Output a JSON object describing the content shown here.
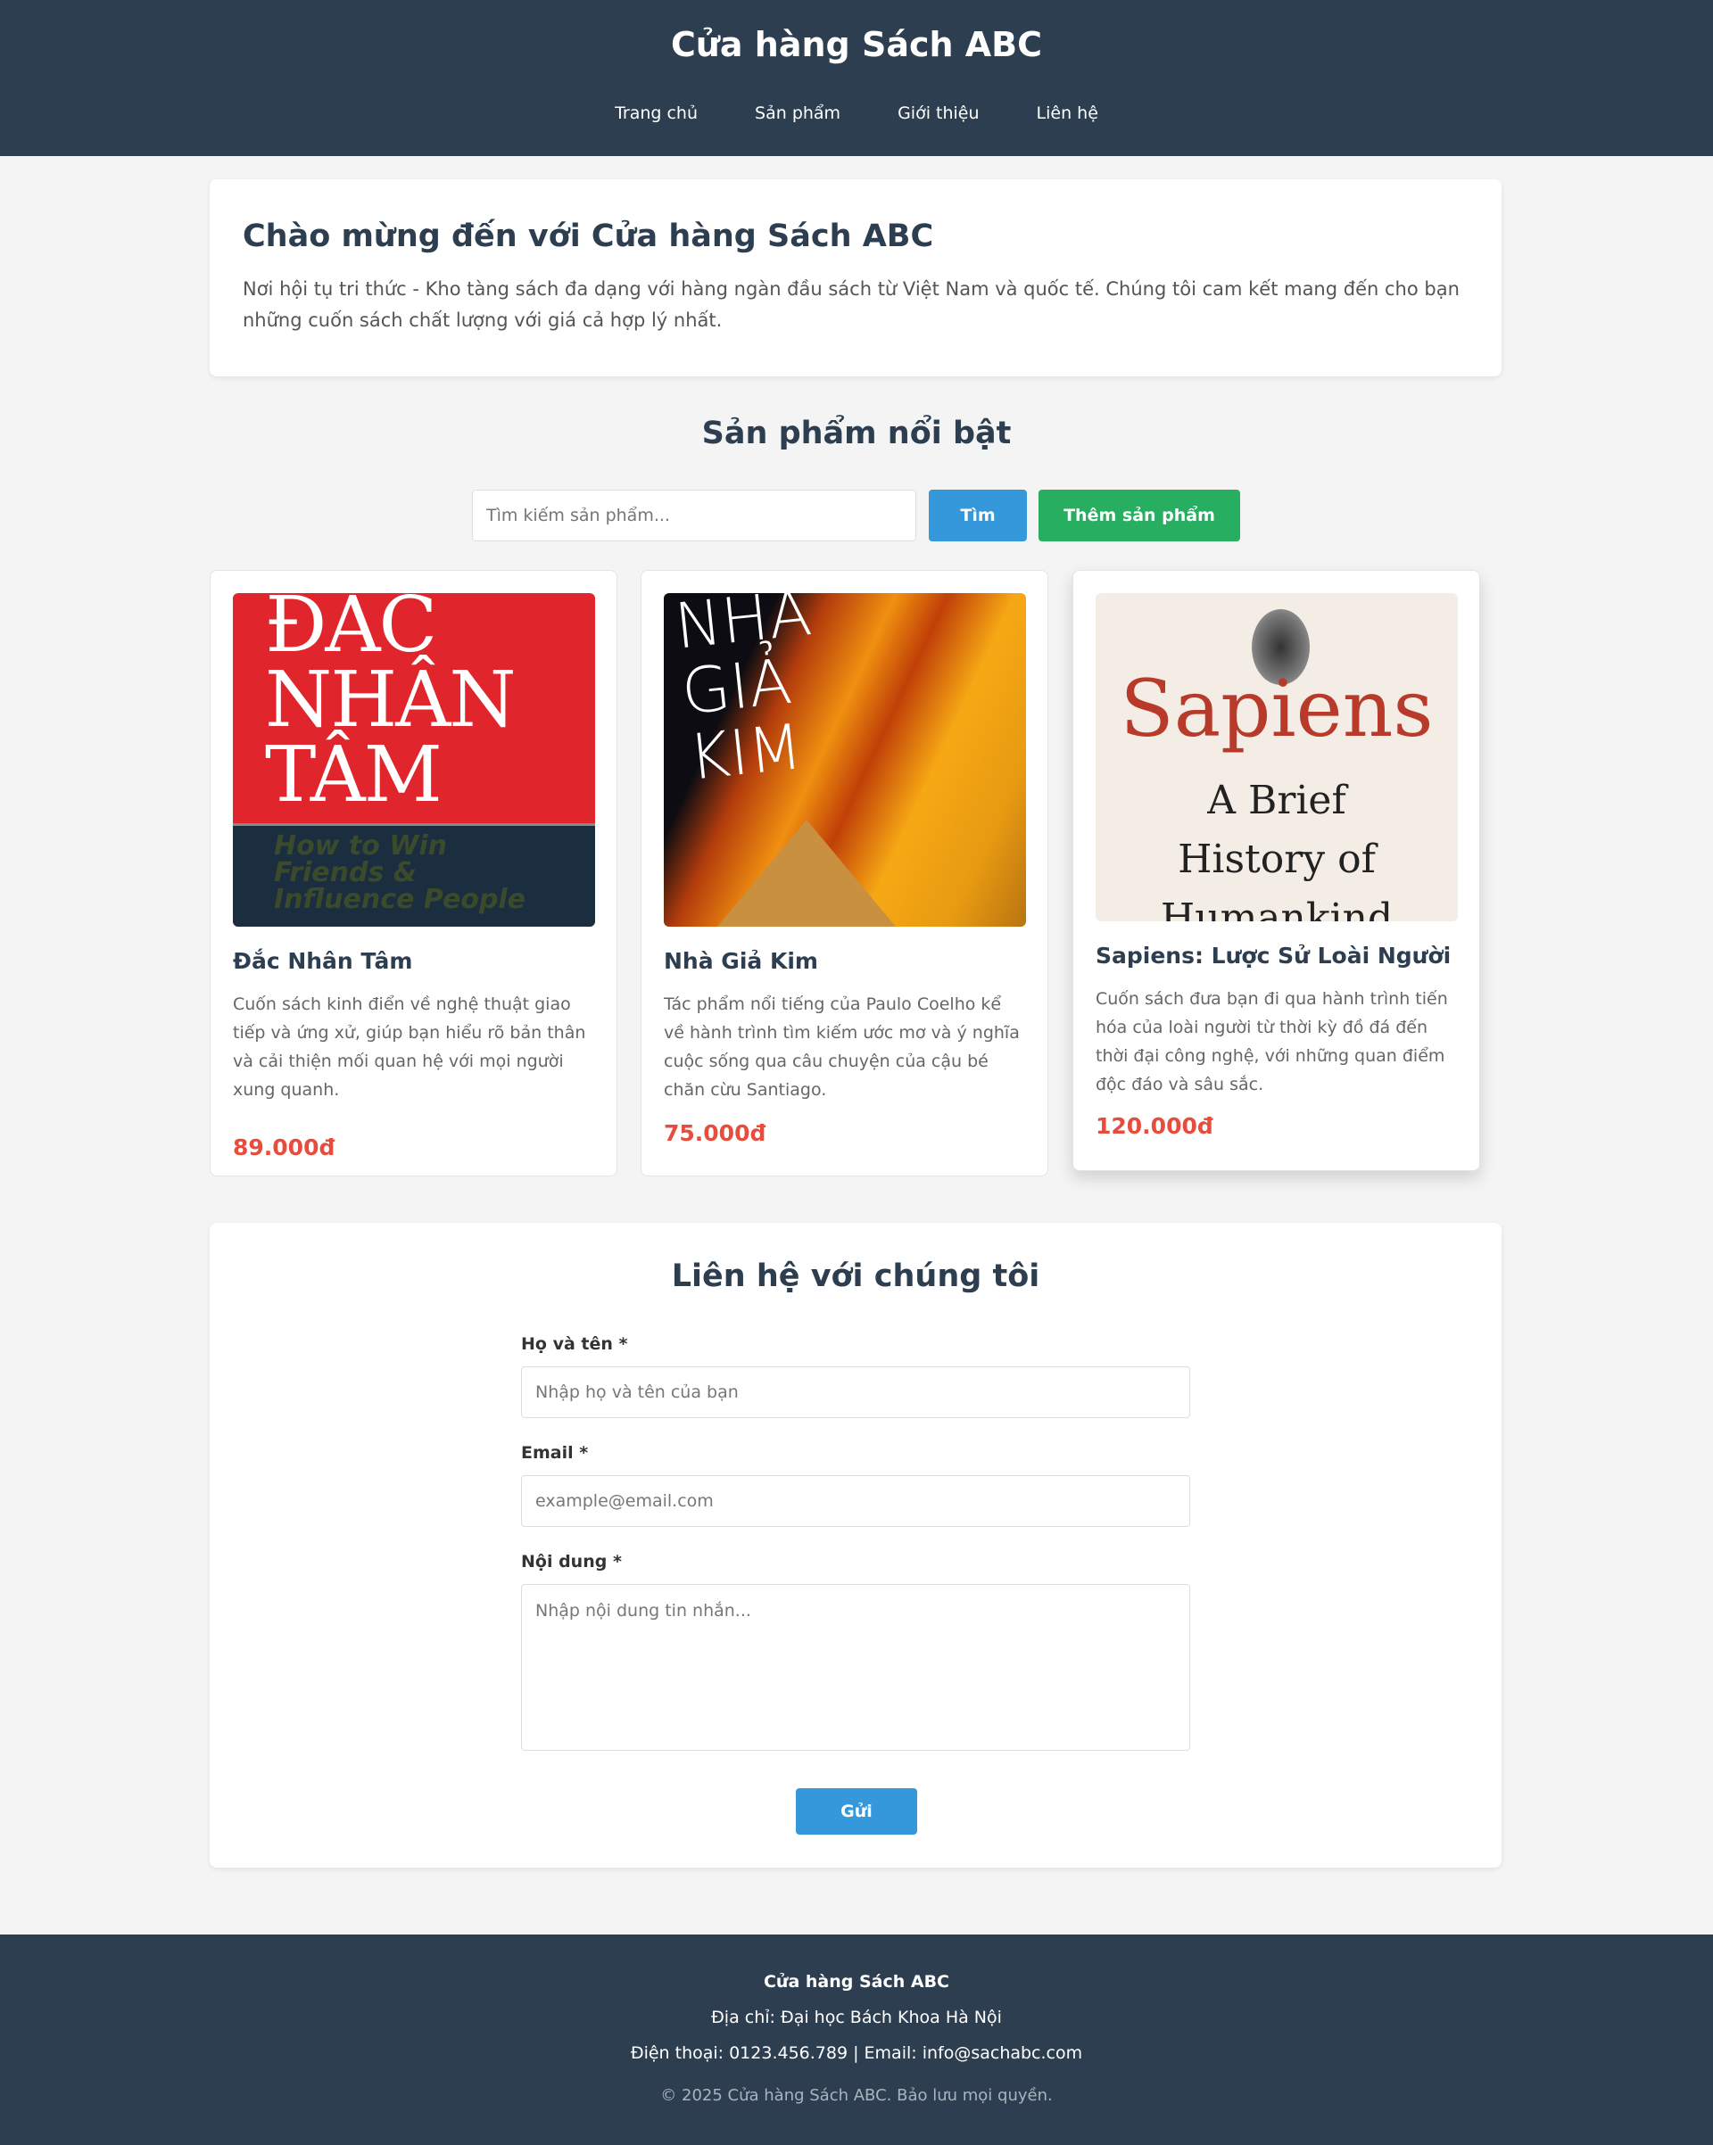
{
  "header": {
    "title": "Cửa hàng Sách ABC",
    "nav": [
      "Trang chủ",
      "Sản phẩm",
      "Giới thiệu",
      "Liên hệ"
    ]
  },
  "welcome": {
    "title": "Chào mừng đến với Cửa hàng Sách ABC",
    "text": "Nơi hội tụ tri thức - Kho tàng sách đa dạng với hàng ngàn đầu sách từ Việt Nam và quốc tế. Chúng tôi cam kết mang đến cho bạn những cuốn sách chất lượng với giá cả hợp lý nhất."
  },
  "products_section": {
    "title": "Sản phẩm nổi bật",
    "search_placeholder": "Tìm kiếm sản phẩm...",
    "search_label": "Tìm",
    "add_label": "Thêm sản phẩm"
  },
  "products": [
    {
      "name": "Đắc Nhân Tâm",
      "desc": "Cuốn sách kinh điển về nghệ thuật giao tiếp và ứng xử, giúp bạn hiểu rõ bản thân và cải thiện mối quan hệ với mọi người xung quanh.",
      "price": "89.000đ",
      "cover_text": "ĐẮC NHÂN TÂM",
      "cover_sub": "How to Win Friends & Influence People"
    },
    {
      "name": "Nhà Giả Kim",
      "desc": "Tác phẩm nổi tiếng của Paulo Coelho kể về hành trình tìm kiếm ước mơ và ý nghĩa cuộc sống qua câu chuyện của cậu bé chăn cừu Santiago.",
      "price": "75.000đ",
      "cover_text": "NHÀ GIẢ KIM"
    },
    {
      "name": "Sapiens: Lược Sử Loài Người",
      "desc": "Cuốn sách đưa bạn đi qua hành trình tiến hóa của loài người từ thời kỳ đồ đá đến thời đại công nghệ, với những quan điểm độc đáo và sâu sắc.",
      "price": "120.000đ",
      "cover_text": "Sapiens",
      "cover_sub": "A Brief History of Humankind"
    }
  ],
  "contact": {
    "title": "Liên hệ với chúng tôi",
    "name_label": "Họ và tên *",
    "name_placeholder": "Nhập họ và tên của bạn",
    "email_label": "Email *",
    "email_placeholder": "example@email.com",
    "message_label": "Nội dung *",
    "message_placeholder": "Nhập nội dung tin nhắn...",
    "submit_label": "Gửi"
  },
  "footer": {
    "name": "Cửa hàng Sách ABC",
    "address": "Địa chỉ: Đại học Bách Khoa Hà Nội",
    "contact": "Điện thoại: 0123.456.789 | Email: info@sachabc.com",
    "copyright": "© 2025 Cửa hàng Sách ABC. Bảo lưu mọi quyền."
  },
  "colors": {
    "header": "#2c3e50",
    "primary": "#3498db",
    "success": "#27ae60",
    "price": "#e74c3c"
  }
}
